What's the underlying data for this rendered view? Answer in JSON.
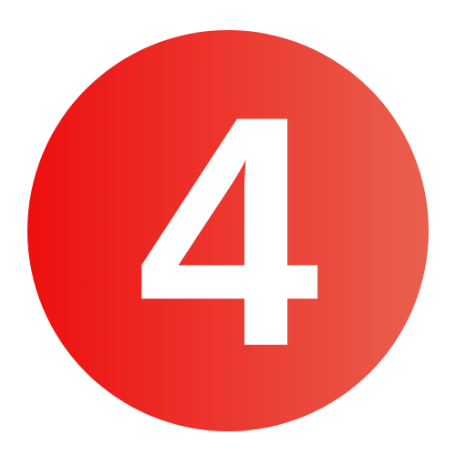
{
  "badge": {
    "number": "4",
    "color_start": "#ee0f0f",
    "color_end": "#e9604f",
    "text_color": "#ffffff"
  }
}
